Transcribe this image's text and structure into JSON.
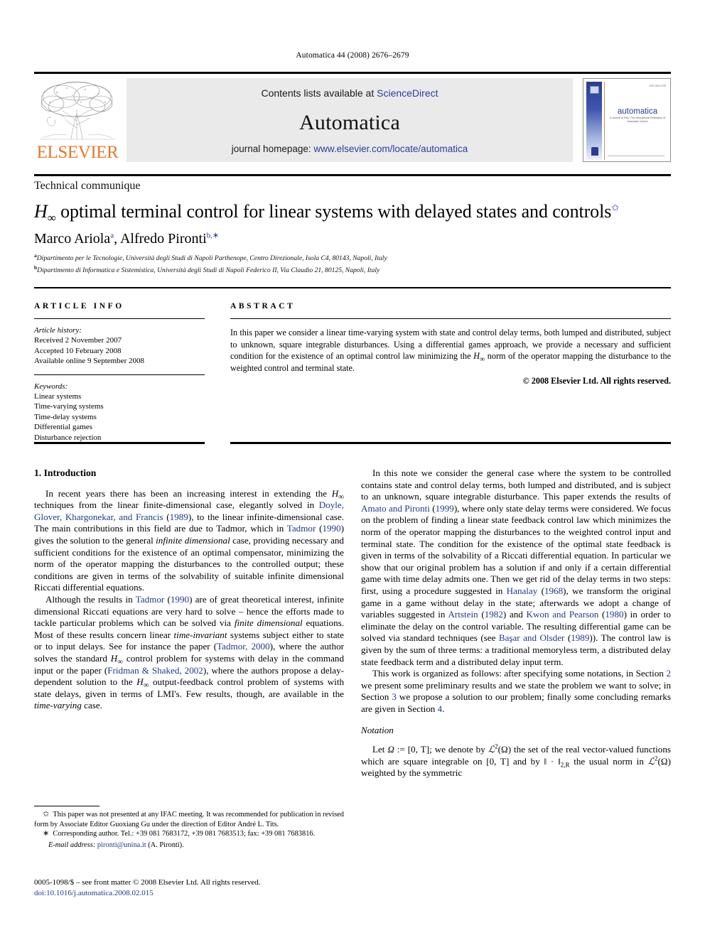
{
  "running_head": "Automatica 44 (2008) 2676–2679",
  "masthead": {
    "publisher_logo_text": "ELSEVIER",
    "contents_prefix": "Contents lists available at ",
    "contents_link": "ScienceDirect",
    "journal_title": "Automatica",
    "homepage_prefix": "journal homepage: ",
    "homepage_link": "www.elsevier.com/locate/automatica",
    "cover": {
      "title": "automatica",
      "subtitle": "A Journal of IFAC The International Federation of Automatic Control",
      "ifac_word": "IFAC",
      "top_code": "ISSN 0005-1098"
    }
  },
  "article": {
    "communique_type": "Technical communique",
    "title_pre": "H",
    "title_sub": "∞",
    "title_rest": " optimal terminal control for linear systems with delayed states and controls",
    "title_footnote_mark": "✩",
    "authors": [
      {
        "name": "Marco Ariola",
        "sup": "a"
      },
      {
        "name": "Alfredo Pironti",
        "sup": "b,∗"
      }
    ],
    "authors_separator": ", ",
    "affiliations": [
      {
        "mark": "a",
        "text": "Dipartimento per le Tecnologie, Università degli Studi di Napoli Parthenope, Centro Direzionale, Isola C4, 80143, Napoli, Italy"
      },
      {
        "mark": "b",
        "text": "Dipartimento di Informatica e Sistemistica, Università degli Studi di Napoli Federico II, Via Claudio 21, 80125, Napoli, Italy"
      }
    ]
  },
  "article_info": {
    "heading": "ARTICLE INFO",
    "history_label": "Article history:",
    "history": [
      "Received 2 November 2007",
      "Accepted 10 February 2008",
      "Available online 9 September 2008"
    ],
    "keywords_label": "Keywords:",
    "keywords": [
      "Linear systems",
      "Time-varying systems",
      "Time-delay systems",
      "Differential games",
      "Disturbance rejection"
    ]
  },
  "abstract": {
    "heading": "ABSTRACT",
    "text_part1": "In this paper we consider a linear time-varying system with state and control delay terms, both lumped and distributed, subject to unknown, square integrable disturbances. Using a differential games approach, we provide a necessary and sufficient condition for the existence of an optimal control law minimizing the ",
    "text_part2": " norm of the operator mapping the disturbance to the weighted control and terminal state.",
    "copyright": "© 2008 Elsevier Ltd. All rights reserved."
  },
  "body": {
    "section1_heading": "1. Introduction",
    "left_p1_a": "In recent years there has been an increasing interest in extending the ",
    "left_p1_b": " techniques from the linear finite-dimensional case, elegantly solved in ",
    "left_p1_ref1": "Doyle, Glover, Khargonekar, and Francis",
    "left_p1_c": " (",
    "left_p1_ref1_year": "1989",
    "left_p1_d": "), to the linear infinite-dimensional case. The main contributions in this field are due to Tadmor, which in ",
    "left_p1_ref2": "Tadmor",
    "left_p1_e": " (",
    "left_p1_ref2_year": "1990",
    "left_p1_f": ") gives the solution to the general ",
    "left_p1_italic1": "infinite dimensional",
    "left_p1_g": " case, providing necessary and sufficient conditions for the existence of an optimal compensator, minimizing the norm of the operator mapping the disturbances to the controlled output; these conditions are given in terms of the solvability of suitable infinite dimensional Riccati differential equations.",
    "left_p2_a": "Although the results in ",
    "left_p2_ref1": "Tadmor",
    "left_p2_b": " (",
    "left_p2_ref1_year": "1990",
    "left_p2_c": ") are of great theoretical interest, infinite dimensional Riccati equations are very hard to solve – hence the efforts made to tackle particular problems which can be solved via ",
    "left_p2_italic1": "finite dimensional",
    "left_p2_d": " equations. Most of these results concern linear ",
    "left_p2_italic2": "time-invariant",
    "left_p2_e": " systems subject either to state or to input delays. See for instance the paper (",
    "left_p2_ref2": "Tadmor, 2000",
    "left_p2_f": "), where the author solves the standard ",
    "left_p2_g": " control problem for systems with delay in the command input or the paper (",
    "left_p2_ref3": "Fridman & Shaked, 2002",
    "left_p2_h": "), where the authors propose a delay-dependent solution to the ",
    "left_p2_i": " output-feedback control problem of systems with state delays, given in terms of LMI's. Few results, though, are available in the ",
    "left_p2_italic3": "time-varying",
    "left_p2_j": " case.",
    "right_p1_a": "In this note we consider the general case where the system to be controlled contains state and control delay terms, both lumped and distributed, and is subject to an unknown, square integrable disturbance. This paper extends the results of ",
    "right_p1_ref1": "Amato and Pironti",
    "right_p1_b": " (",
    "right_p1_ref1_year": "1999",
    "right_p1_c": "), where only state delay terms were considered. We focus on the problem of finding a linear state feedback control law which minimizes the norm of the operator mapping the disturbances to the weighted control input and terminal state. The condition for the existence of the optimal state feedback is given in terms of the solvability of a Riccati differential equation. In particular we show that our original problem has a solution if and only if a certain differential game with time delay admits one. Then we get rid of the delay terms in two steps: first, using a procedure suggested in ",
    "right_p1_ref2": "Hanalay",
    "right_p1_d": " (",
    "right_p1_ref2_year": "1968",
    "right_p1_e": "), we transform the original game in a game without delay in the state; afterwards we adopt a change of variables suggested in ",
    "right_p1_ref3": "Artstein",
    "right_p1_f": " (",
    "right_p1_ref3_year": "1982",
    "right_p1_g": ") and ",
    "right_p1_ref4": "Kwon and Pearson",
    "right_p1_h": " (",
    "right_p1_ref4_year": "1980",
    "right_p1_i": ") in order to eliminate the delay on the control variable. The resulting differential game can be solved via standard techniques (see ",
    "right_p1_ref5": "Başar and Olsder",
    "right_p1_j": " (",
    "right_p1_ref5_year": "1989",
    "right_p1_k": ")). The control law is given by the sum of three terms: a traditional memoryless term, a distributed delay state feedback term and a distributed delay input term.",
    "right_p2_a": "This work is organized as follows: after specifying some notations, in Section ",
    "right_p2_sec2": "2",
    "right_p2_b": " we present some preliminary results and we state the problem we want to solve; in Section ",
    "right_p2_sec3": "3",
    "right_p2_c": " we propose a solution to our problem; finally some concluding remarks are given in Section ",
    "right_p2_sec4": "4",
    "right_p2_d": ".",
    "notation_heading": "Notation",
    "notation_a": "Let ",
    "notation_omega": "Ω",
    "notation_b": " := [0, T]; we denote by ",
    "notation_l2": "ℒ",
    "notation_sup2": "2",
    "notation_c": "(Ω) the set of the real vector-valued functions which are square integrable on [0, T] and by ",
    "notation_norm": "‖ · ‖",
    "notation_sub2r": "2,R",
    "notation_d": " the usual norm in ",
    "notation_e": "(Ω) weighted by the symmetric"
  },
  "footnotes": {
    "star_mark": "✩",
    "star_text": "This paper was not presented at any IFAC meeting. It was recommended for publication in revised form by Associate Editor Guoxiang Gu under the direction of Editor André L. Tits.",
    "corr_mark": "∗",
    "corr_text": "Corresponding author. Tel.: +39 081 7683172, +39 081 7683513; fax: +39 081 7683816.",
    "email_label": "E-mail address:",
    "email_address": "pironti@unina.it",
    "email_author": "(A. Pironti).",
    "issn_line": "0005-1098/$ – see front matter © 2008 Elsevier Ltd. All rights reserved.",
    "doi_line": "doi:10.1016/j.automatica.2008.02.015"
  },
  "colors": {
    "link_blue": "#2b3c9e",
    "ref_blue": "#1e3a8a",
    "elsevier_orange": "#E8762A",
    "band_gray": "#eaeaea"
  }
}
